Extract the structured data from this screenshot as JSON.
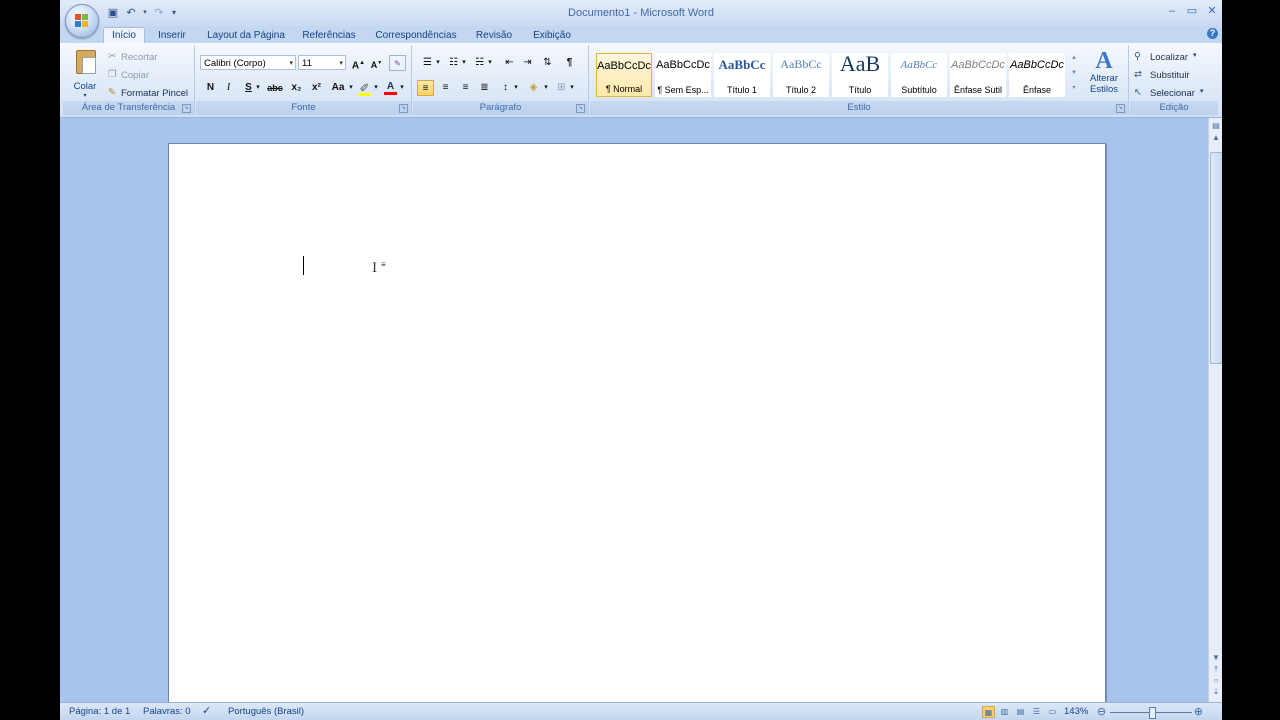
{
  "window": {
    "title": "Documento1 - Microsoft Word",
    "controls": [
      "minimize-icon",
      "maximize-icon",
      "close-icon"
    ]
  },
  "quick_access": [
    "save-icon",
    "undo-icon",
    "redo-icon",
    "customize-icon"
  ],
  "tabs": [
    {
      "label": "Início",
      "active": true
    },
    {
      "label": "Inserir"
    },
    {
      "label": "Layout da Página"
    },
    {
      "label": "Referências"
    },
    {
      "label": "Correspondências"
    },
    {
      "label": "Revisão"
    },
    {
      "label": "Exibição"
    }
  ],
  "clipboard": {
    "paste": "Colar",
    "cut": "Recortar",
    "copy": "Copiar",
    "format_painter": "Formatar Pincel",
    "group_label": "Área de Transferência"
  },
  "font": {
    "family": "Calibri (Corpo)",
    "size": "11",
    "group_label": "Fonte",
    "buttons": {
      "bold": "N",
      "italic": "I",
      "underline": "S",
      "strike": "abc",
      "subscript": "x₂",
      "superscript": "x²",
      "case": "Aa",
      "grow": "A",
      "shrink": "A"
    }
  },
  "paragraph": {
    "group_label": "Parágrafo",
    "pilcrow": "¶"
  },
  "styles": {
    "group_label": "Estilo",
    "items": [
      {
        "preview": "AaBbCcDc",
        "name": "¶ Normal",
        "selected": true
      },
      {
        "preview": "AaBbCcDc",
        "name": "¶ Sem Esp..."
      },
      {
        "preview": "AaBbCc",
        "name": "Título 1"
      },
      {
        "preview": "AaBbCc",
        "name": "Título 2"
      },
      {
        "preview": "AaB",
        "name": "Título"
      },
      {
        "preview": "AaBbCc",
        "name": "Subtítulo"
      },
      {
        "preview": "AaBbCcDc",
        "name": "Ênfase Sutil"
      },
      {
        "preview": "AaBbCcDc",
        "name": "Ênfase"
      }
    ],
    "change_styles": "Alterar Estilos"
  },
  "editing": {
    "group_label": "Edição",
    "find": "Localizar",
    "replace": "Substituir",
    "select": "Selecionar"
  },
  "status": {
    "page": "Página: 1 de 1",
    "words": "Palavras: 0",
    "language": "Português (Brasil)",
    "zoom": "143%"
  },
  "colors": {
    "highlight": "#ffff00",
    "font_color": "#ff0000"
  }
}
